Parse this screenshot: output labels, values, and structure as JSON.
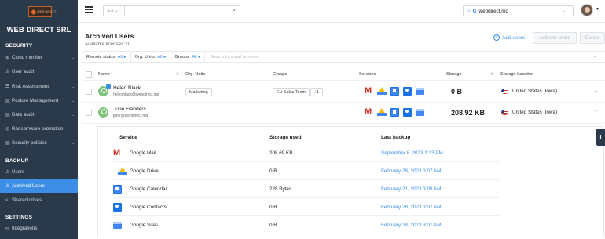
{
  "sidebar": {
    "logo_text": "WEB DIRECT",
    "org_name": "WEB DIRECT SRL",
    "sections": [
      {
        "title": "SECURITY"
      },
      {
        "title": "BACKUP"
      },
      {
        "title": "SETTINGS"
      }
    ],
    "items": [
      {
        "label": "Cloud monitor",
        "icon": "globe-icon"
      },
      {
        "label": "User audit",
        "icon": "person-icon"
      },
      {
        "label": "Risk Assessment",
        "icon": "list-icon"
      },
      {
        "label": "Posture Management",
        "icon": "doc-icon"
      },
      {
        "label": "Data audit",
        "icon": "database-icon"
      },
      {
        "label": "Ransomware protection",
        "icon": "shield-icon"
      },
      {
        "label": "Security policies",
        "icon": "policy-icon"
      },
      {
        "label": "Users",
        "icon": "users-icon"
      },
      {
        "label": "Archived Users",
        "icon": "archived-users-icon"
      },
      {
        "label": "Shared drives",
        "icon": "share-icon"
      },
      {
        "label": "Integrations",
        "icon": "link-icon"
      }
    ]
  },
  "topbar": {
    "domain": "webdirect.md"
  },
  "main": {
    "title": "Archived Users",
    "licenses": "Available licenses: 0",
    "add_users": "Add users",
    "activate_users": "Activate users",
    "delete": "Delete",
    "filters": {
      "remote_status_label": "Remote status:",
      "remote_status_value": "All",
      "org_units_label": "Org. Units:",
      "org_units_value": "All",
      "groups_label": "Groups:",
      "groups_value": "All",
      "search_placeholder": "Search by email or name"
    },
    "columns": [
      "Name",
      "Org. Units",
      "Groups",
      "Services",
      "Storage",
      "Storage Location"
    ],
    "users": [
      {
        "name": "Helen Black",
        "email": "helenblack@webdirect.md",
        "org_unit": "Marketing",
        "group": "EU Sales Team",
        "extra_groups": "+1",
        "storage": "0 B",
        "location": "United States (Iowa)"
      },
      {
        "name": "June Flanders",
        "email": "june@webdirect.md",
        "org_unit": "",
        "group": "",
        "extra_groups": "",
        "storage": "208.92 KB",
        "location": "United States (Iowa)"
      }
    ],
    "detail": {
      "headers": {
        "service": "Service",
        "storage": "Storage used",
        "backup": "Last backup"
      },
      "rows": [
        {
          "service": "Google Mail",
          "icon": "gmail-icon",
          "storage": "208.69 KB",
          "backup": "September 8, 2023 1:33 PM"
        },
        {
          "service": "Google Drive",
          "icon": "drive-icon",
          "storage": "0 B",
          "backup": "February 28, 2023 3:07 AM"
        },
        {
          "service": "Google Calendar",
          "icon": "calendar-icon",
          "storage": "228 Bytes",
          "backup": "February 21, 2023 3:09 AM"
        },
        {
          "service": "Google Contacts",
          "icon": "contacts-icon",
          "storage": "0 B",
          "backup": "February 28, 2023 3:07 AM"
        },
        {
          "service": "Google Sites",
          "icon": "sites-icon",
          "storage": "0 B",
          "backup": "February 28, 2023 3:07 AM"
        }
      ]
    }
  }
}
